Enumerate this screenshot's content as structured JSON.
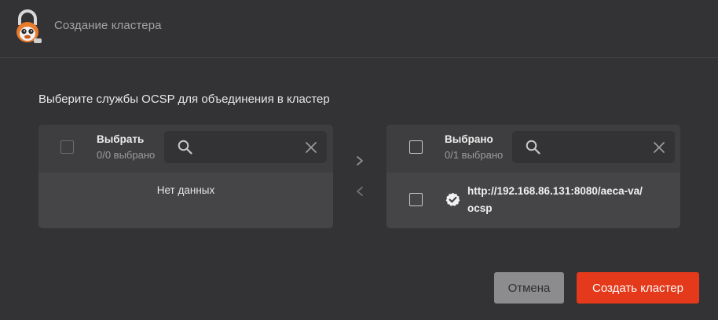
{
  "header": {
    "title": "Создание кластера"
  },
  "prompt": "Выберите службы OCSP для объединения в кластер",
  "left_panel": {
    "label": "Выбрать",
    "count": "0/0 выбрано",
    "search": {
      "value": "",
      "placeholder": ""
    },
    "empty_text": "Нет данных"
  },
  "right_panel": {
    "label": "Выбрано",
    "count": "0/1 выбрано",
    "search": {
      "value": "",
      "placeholder": ""
    },
    "items": [
      {
        "text": "http://192.168.86.131:8080/aeca-va/ocsp",
        "status_icon": "check-circle-icon"
      }
    ]
  },
  "transfer": {
    "move_right_icon": "chevron-right-icon",
    "move_left_icon": "chevron-left-icon"
  },
  "buttons": {
    "cancel": "Отмена",
    "create": "Создать кластер"
  },
  "colors": {
    "accent": "#e4391a",
    "background": "#333335",
    "panel": "#454547"
  }
}
